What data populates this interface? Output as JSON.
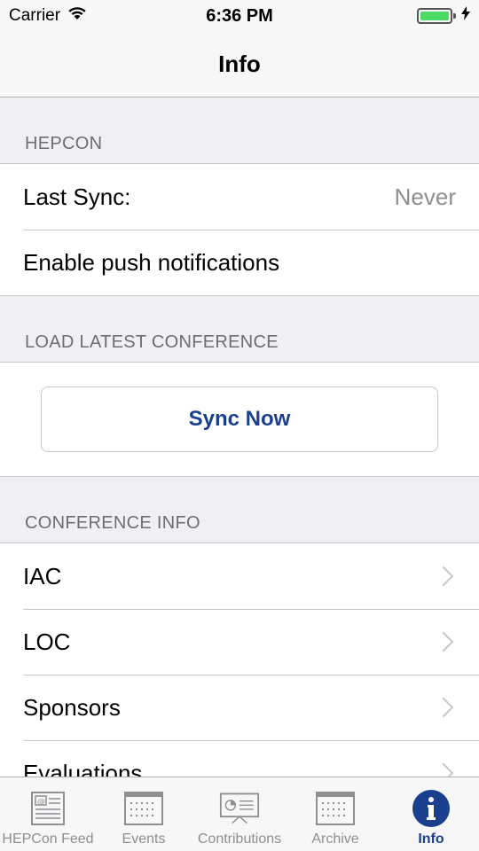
{
  "status_bar": {
    "carrier": "Carrier",
    "time": "6:36 PM"
  },
  "nav": {
    "title": "Info"
  },
  "sections": {
    "hepcon": {
      "header": "HEPCON",
      "last_sync_label": "Last Sync:",
      "last_sync_value": "Never",
      "push_label": "Enable push notifications"
    },
    "load": {
      "header": "LOAD LATEST CONFERENCE",
      "sync_button": "Sync Now"
    },
    "conference_info": {
      "header": "CONFERENCE INFO",
      "items": [
        "IAC",
        "LOC",
        "Sponsors",
        "Evaluations"
      ]
    }
  },
  "tabbar": {
    "tabs": [
      {
        "label": "HEPCon Feed",
        "icon": "feed-icon"
      },
      {
        "label": "Events",
        "icon": "calendar-icon"
      },
      {
        "label": "Contributions",
        "icon": "presentation-icon"
      },
      {
        "label": "Archive",
        "icon": "archive-icon"
      },
      {
        "label": "Info",
        "icon": "info-icon",
        "active": true
      }
    ]
  },
  "colors": {
    "accent": "#1b3f8f",
    "battery": "#4cd964",
    "background": "#efeff4"
  }
}
